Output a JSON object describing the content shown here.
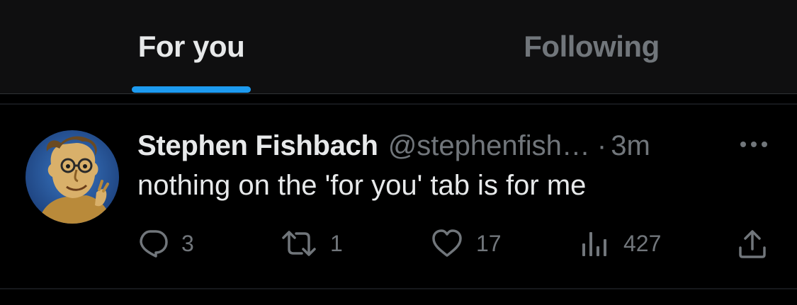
{
  "tabs": [
    {
      "label": "For you",
      "active": true
    },
    {
      "label": "Following",
      "active": false
    }
  ],
  "colors": {
    "background": "#000000",
    "tab_bar": "#0f0f10",
    "accent": "#1d9bf0",
    "text_primary": "#e7e9ea",
    "text_secondary": "#71767b"
  },
  "tweet": {
    "author_name": "Stephen Fishbach",
    "handle": "@stephenfish…",
    "separator": "·",
    "time": "3m",
    "text": "nothing on the 'for you' tab is for me",
    "avatar_icon": "cartoon-portrait-avatar",
    "actions": {
      "reply_count": "3",
      "retweet_count": "1",
      "like_count": "17",
      "views_count": "427"
    },
    "icons": [
      "reply-icon",
      "retweet-icon",
      "like-icon",
      "views-icon",
      "share-icon",
      "more-options-icon"
    ]
  }
}
